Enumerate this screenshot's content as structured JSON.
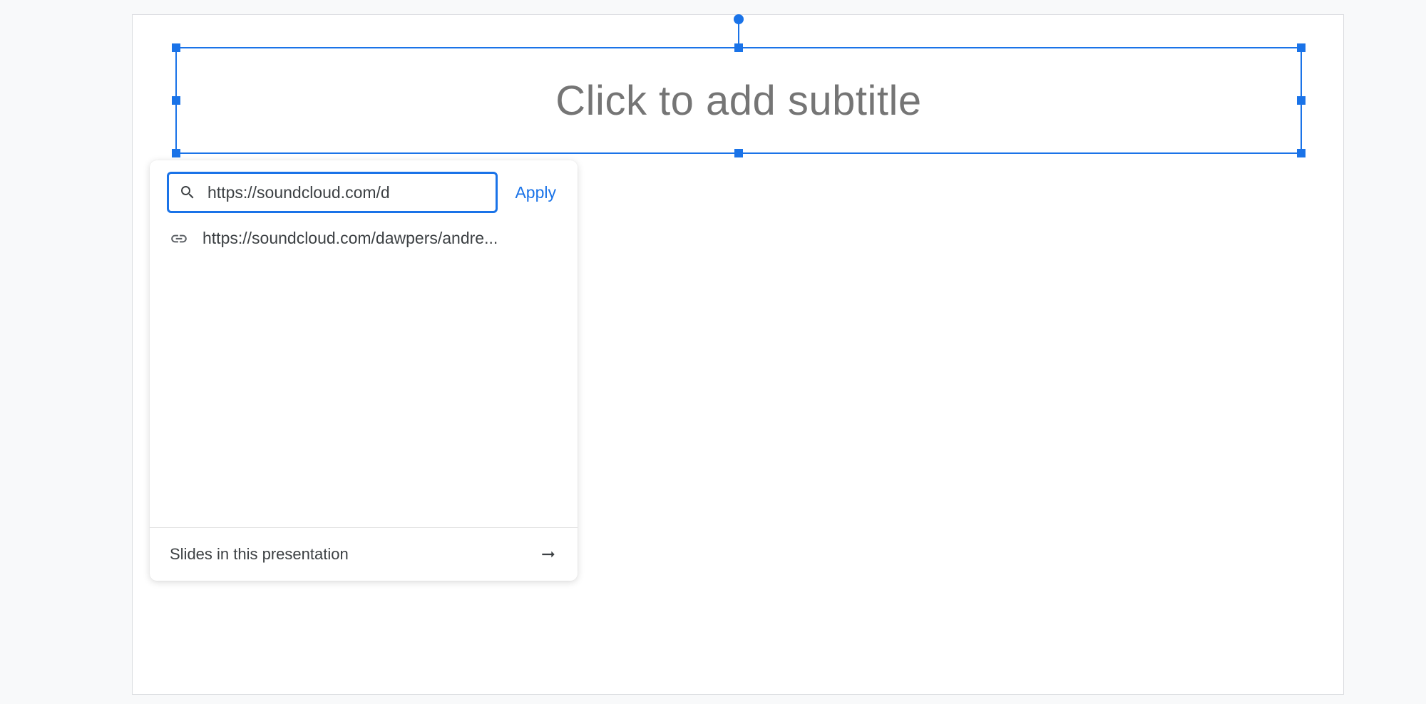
{
  "slide": {
    "subtitle_placeholder": "Click to add subtitle"
  },
  "link_popup": {
    "input_value": "https://soundcloud.com/d",
    "apply_label": "Apply",
    "suggestion": "https://soundcloud.com/dawpers/andre...",
    "footer_label": "Slides in this presentation"
  }
}
